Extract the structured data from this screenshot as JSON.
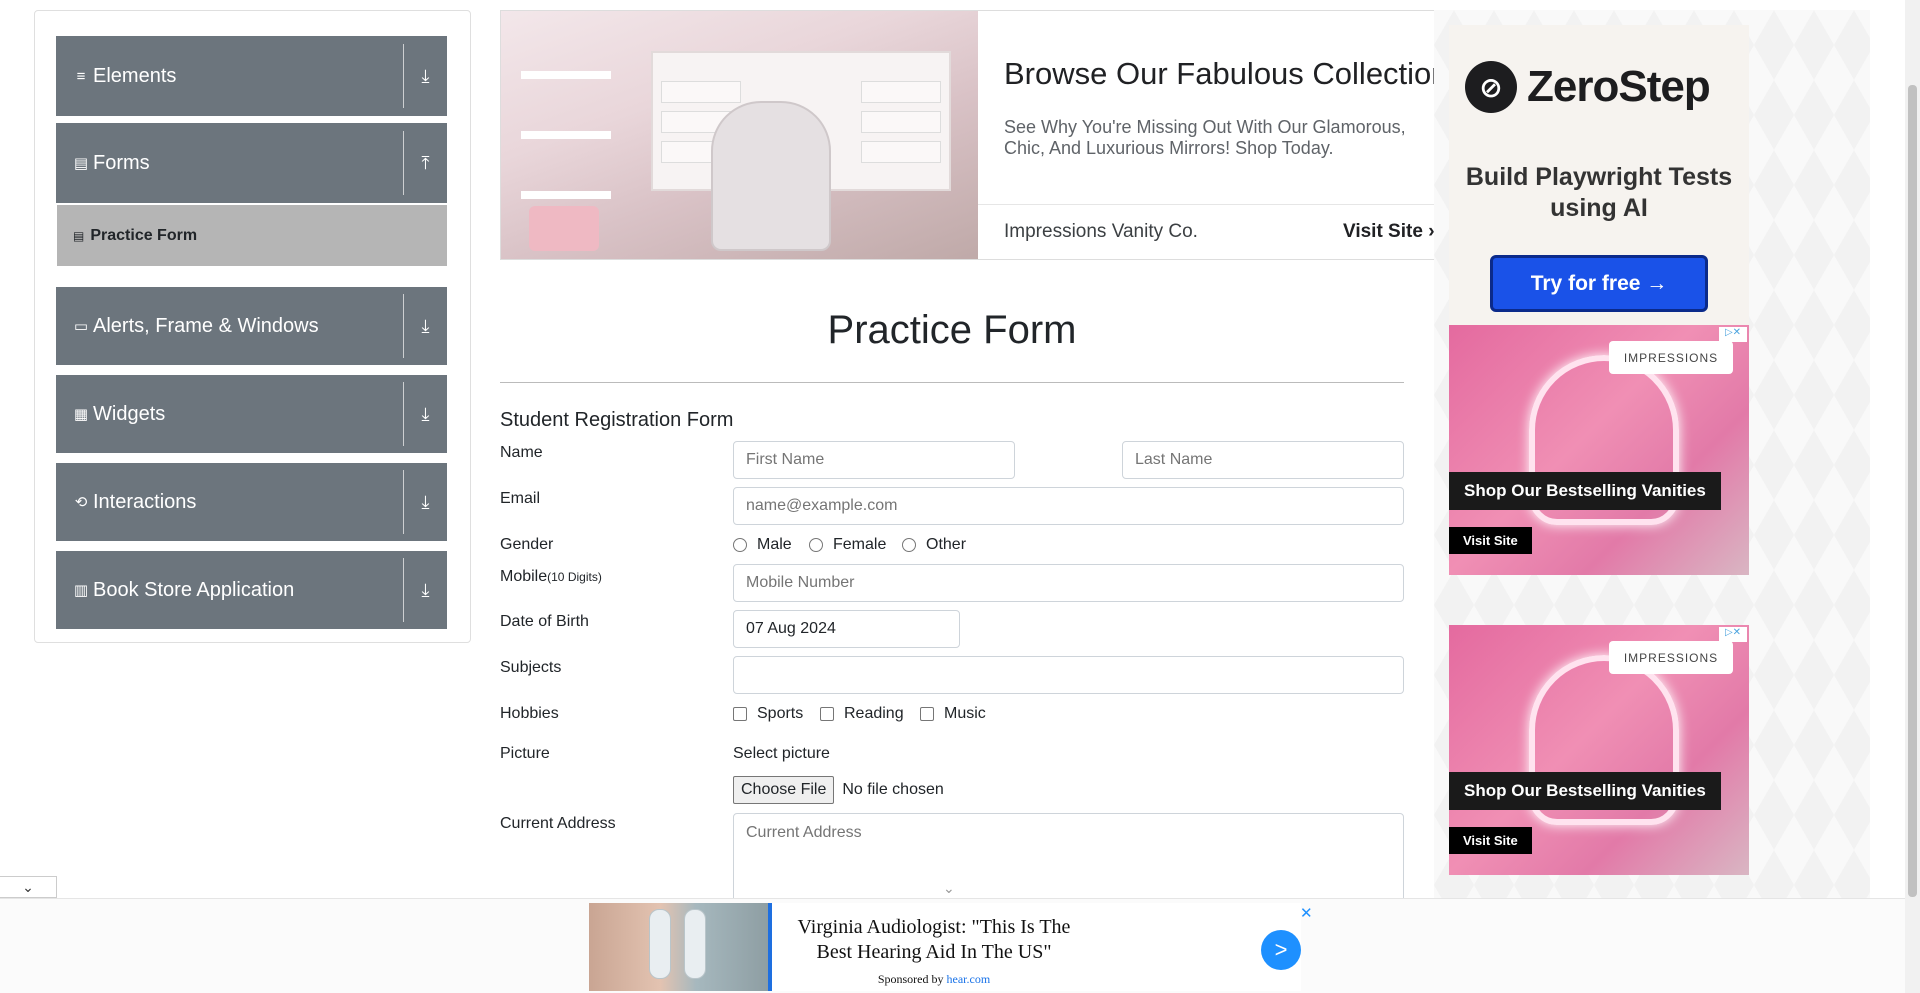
{
  "sidebar": {
    "groups": [
      {
        "label": "Elements",
        "icon": "≡",
        "arrow": "⤓"
      },
      {
        "label": "Forms",
        "icon": "▤",
        "arrow": "⤒"
      },
      {
        "label": "Alerts, Frame & Windows",
        "icon": "▭",
        "arrow": "⤓"
      },
      {
        "label": "Widgets",
        "icon": "▦",
        "arrow": "⤓"
      },
      {
        "label": "Interactions",
        "icon": "⟲",
        "arrow": "⤓"
      },
      {
        "label": "Book Store Application",
        "icon": "▥",
        "arrow": "⤓"
      }
    ],
    "active_item": {
      "label": "Practice Form",
      "icon": "▤"
    }
  },
  "banner_ad": {
    "title": "Browse Our Fabulous Collection",
    "text": "See Why You're Missing Out With Our Glamorous, Chic, And Luxurious Mirrors! Shop Today.",
    "brand": "Impressions Vanity Co.",
    "cta": "Visit Site",
    "cta_arrow": "›"
  },
  "zerostep_ad": {
    "logo_mark": "⊘",
    "name": "ZeroStep",
    "tagline": "Build Playwright Tests using AI",
    "button": "Try for free →"
  },
  "vanity_ads": [
    {
      "brand": "IMPRESSIONS",
      "headline": "Shop Our Bestselling Vanities",
      "cta": "Visit Site",
      "adchoice": "▷✕"
    },
    {
      "brand": "IMPRESSIONS",
      "headline": "Shop Our Bestselling Vanities",
      "cta": "Visit Site",
      "adchoice": "▷✕"
    }
  ],
  "form": {
    "heading": "Practice Form",
    "title": "Student Registration Form",
    "name_label": "Name",
    "first_name_placeholder": "First Name",
    "last_name_placeholder": "Last Name",
    "email_label": "Email",
    "email_placeholder": "name@example.com",
    "gender_label": "Gender",
    "gender_options": [
      "Male",
      "Female",
      "Other"
    ],
    "mobile_label": "Mobile",
    "mobile_hint": "(10 Digits)",
    "mobile_placeholder": "Mobile Number",
    "dob_label": "Date of Birth",
    "dob_value": "07 Aug 2024",
    "subjects_label": "Subjects",
    "subjects_value": "",
    "hobbies_label": "Hobbies",
    "hobbies_options": [
      "Sports",
      "Reading",
      "Music"
    ],
    "picture_label": "Picture",
    "select_picture": "Select picture",
    "choose_file": "Choose File",
    "no_file": "No file chosen",
    "address_label": "Current Address",
    "address_placeholder": "Current Address"
  },
  "bottom_ad": {
    "headline": "Virginia Audiologist: \"This Is The Best Hearing Aid In The US\"",
    "sponsored_prefix": "Sponsored by ",
    "sponsor": "hear.com",
    "go": ">",
    "close": "✕"
  },
  "collapse_tab": "⌄"
}
